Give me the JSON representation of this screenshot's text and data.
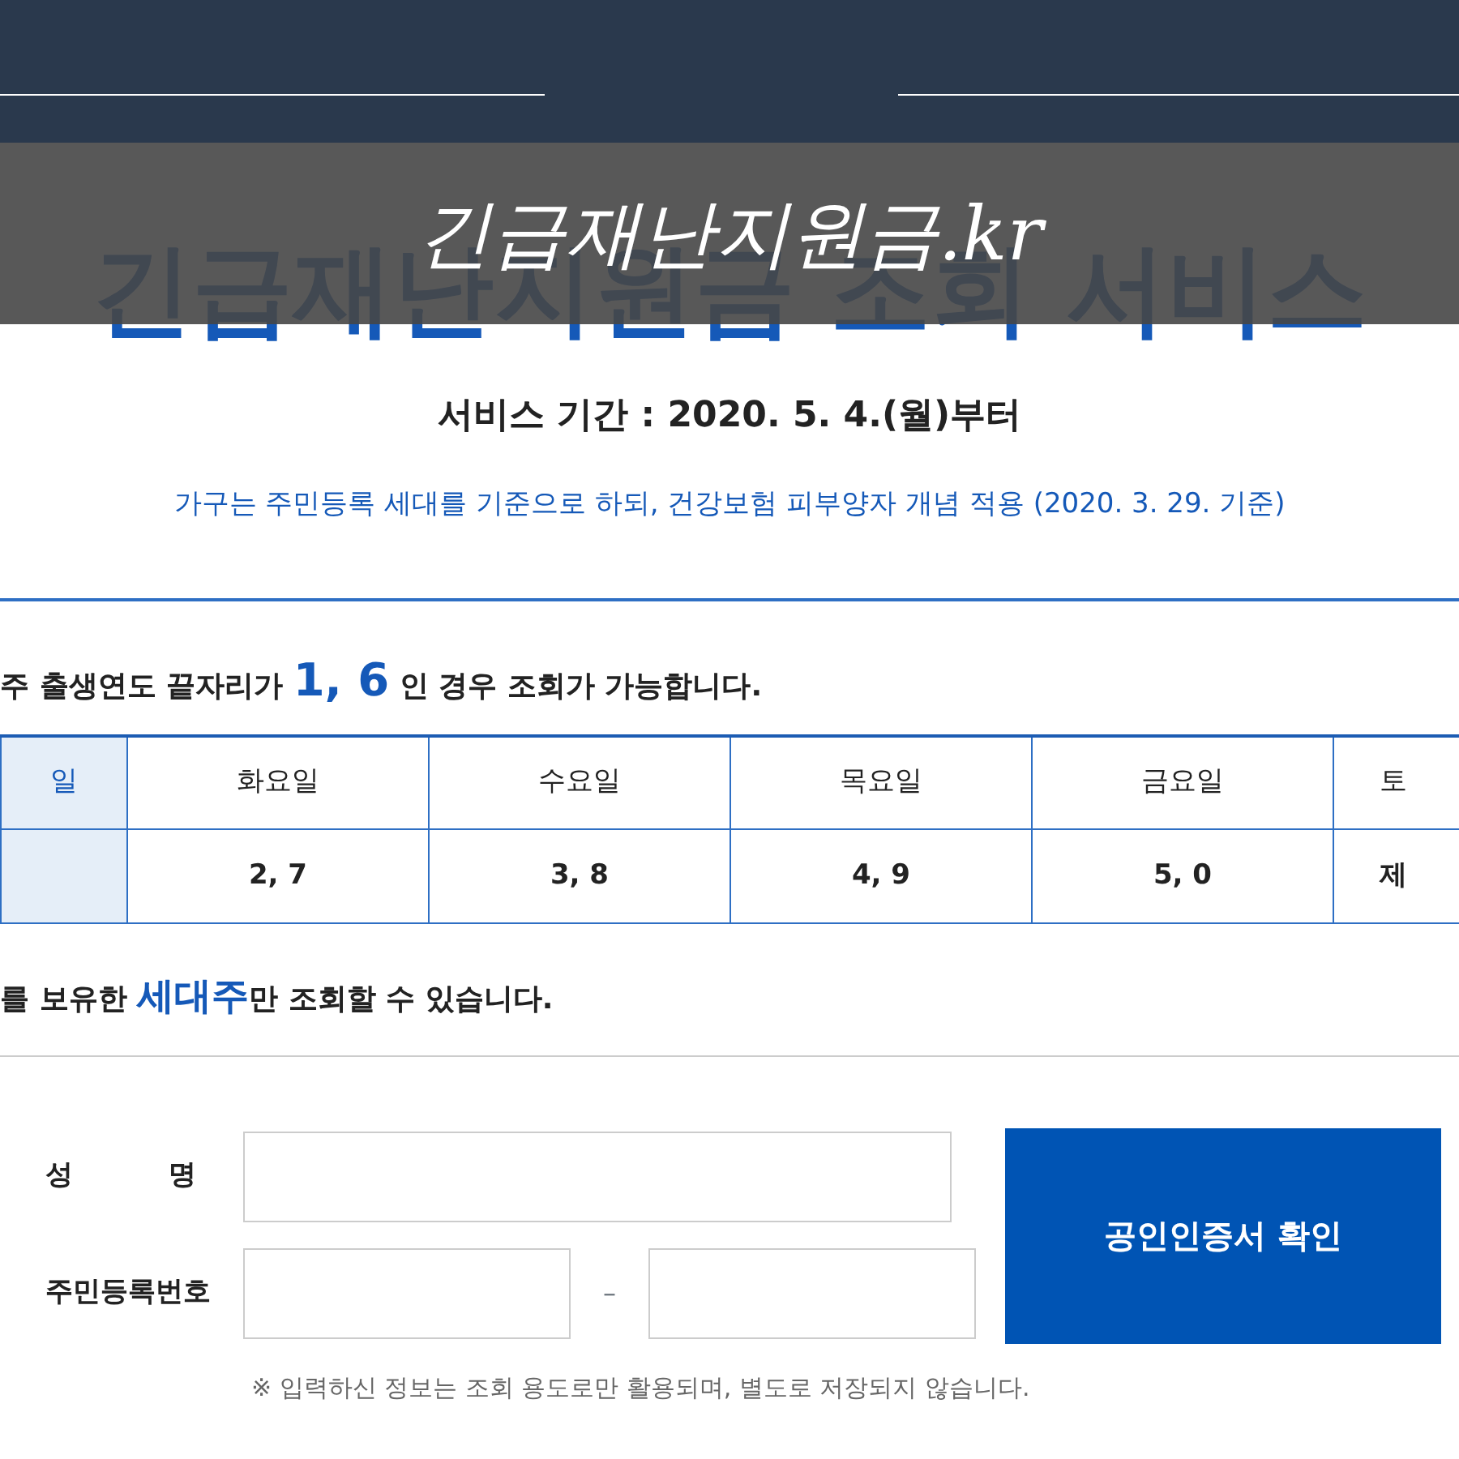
{
  "caption": "긴급재난지원금.kr",
  "page_title": "긴급재난지원금 조회 서비스",
  "service_period": "서비스 기간 : 2020. 5. 4.(월)부터",
  "household_note": "가구는 주민등록 세대를 기준으로 하되, 건강보험 피부양자 개념 적용 (2020. 3. 29. 기준)",
  "schedule_notice": "주 출생연도 끝자리가 **1, 6** 인 경우 조회가 가능합니다.",
  "schedule_table": {
    "columns": [
      {
        "day": "일",
        "selected": true
      },
      {
        "day": "화요일",
        "digits": "2, 7",
        "selected": false
      },
      {
        "day": "수요일",
        "digits": "3, 8",
        "selected": false
      },
      {
        "day": "목요일",
        "digits": "4, 9",
        "selected": false
      },
      {
        "day": "금요일",
        "digits": "5, 0",
        "selected": false
      },
      {
        "day": "토",
        "digits": "제",
        "selected": false
      }
    ]
  },
  "owner_notice": "를 보유한 **세대주**만 조회할 수 있습니다.",
  "form": {
    "name_label": "성          명",
    "id_label": "주민등록번호",
    "id_separator": "–",
    "submit_button": "공인인증서 확인",
    "privacy_note": "※ 입력하신 정보는 조회 용도로만 활용되며, 별도로 저장되지 않습니다."
  }
}
